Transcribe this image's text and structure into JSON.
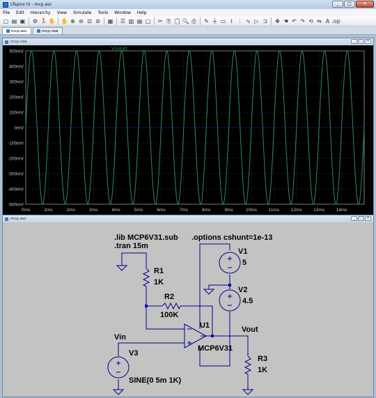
{
  "window": {
    "title": "LTspice IV - mcp.asc"
  },
  "menu": {
    "items": [
      "File",
      "Edit",
      "Hierarchy",
      "View",
      "Simulate",
      "Tools",
      "Window",
      "Help"
    ]
  },
  "tabs": [
    {
      "label": "mcp.asc"
    },
    {
      "label": "mcp.raw"
    }
  ],
  "wave_window": {
    "title": "mcp.raw"
  },
  "sch_window": {
    "title": "mcp.asc"
  },
  "chart_data": {
    "type": "line",
    "series": [
      {
        "name": "V(vout)",
        "color": "#2e8b57",
        "amplitude_mV": 500,
        "frequency_Hz": 1000
      }
    ],
    "xlim": [
      0,
      15
    ],
    "ylim": [
      -500,
      500
    ],
    "x_ticks": [
      "0ms",
      "1ms",
      "2ms",
      "3ms",
      "4ms",
      "5ms",
      "6ms",
      "7ms",
      "8ms",
      "9ms",
      "10ms",
      "11ms",
      "12ms",
      "13ms",
      "14ms"
    ],
    "y_ticks": [
      "500mV",
      "400mV",
      "300mV",
      "200mV",
      "100mV",
      "0mV",
      "-100mV",
      "-200mV",
      "-300mV",
      "-400mV",
      "-500mV"
    ],
    "grid": true,
    "background": "#000000"
  },
  "schematic": {
    "directive_lib": ".lib MCP6V31.sub",
    "directive_tran": ".tran 15m",
    "directive_options": ".options cshunt=1e-13",
    "v1_name": "V1",
    "v1_value": "5",
    "v2_name": "V2",
    "v2_value": "4.5",
    "v3_name": "V3",
    "v3_value": "SINE(0 5m 1K)",
    "r1_name": "R1",
    "r1_value": "1K",
    "r2_name": "R2",
    "r2_value": "100K",
    "r3_name": "R3",
    "r3_value": "1K",
    "u1_name": "U1",
    "u1_value": "MCP6V31",
    "label_vin": "Vin",
    "label_vout": "Vout"
  }
}
